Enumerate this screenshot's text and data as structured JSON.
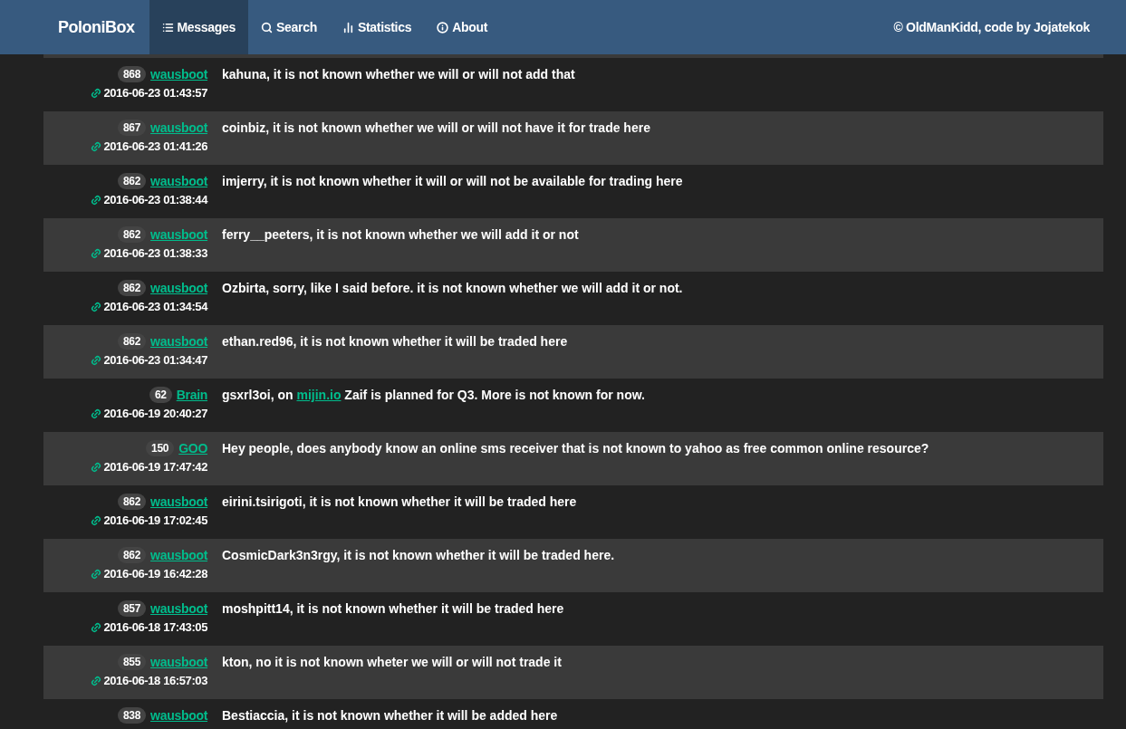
{
  "navbar": {
    "brand": "PoloniBox",
    "items": [
      {
        "label": "Messages",
        "kind": "list",
        "selected": true
      },
      {
        "label": "Search",
        "kind": "search",
        "selected": false
      },
      {
        "label": "Statistics",
        "kind": "chart",
        "selected": false
      },
      {
        "label": "About",
        "kind": "info",
        "selected": false
      }
    ],
    "credit": "© OldManKidd, code by Jojatekok"
  },
  "messages": [
    {
      "count": "868",
      "user": "wausboot",
      "time": "2016-06-23 01:43:57",
      "parts": [
        {
          "kind": "text",
          "text": "kahuna, it is not known whether we will or will not add that"
        }
      ]
    },
    {
      "count": "867",
      "user": "wausboot",
      "time": "2016-06-23 01:41:26",
      "parts": [
        {
          "kind": "text",
          "text": "coinbiz, it is not known whether we will or will not have it for trade here"
        }
      ]
    },
    {
      "count": "862",
      "user": "wausboot",
      "time": "2016-06-23 01:38:44",
      "parts": [
        {
          "kind": "text",
          "text": "imjerry, it is not known whether it will or will not be available for trading here"
        }
      ]
    },
    {
      "count": "862",
      "user": "wausboot",
      "time": "2016-06-23 01:38:33",
      "parts": [
        {
          "kind": "text",
          "text": "ferry__peeters, it is not known whether we will add it or not"
        }
      ]
    },
    {
      "count": "862",
      "user": "wausboot",
      "time": "2016-06-23 01:34:54",
      "parts": [
        {
          "kind": "text",
          "text": "Ozbirta, sorry, like I said before. it is not known whether we will add it or not."
        }
      ]
    },
    {
      "count": "862",
      "user": "wausboot",
      "time": "2016-06-23 01:34:47",
      "parts": [
        {
          "kind": "text",
          "text": "ethan.red96, it is not known whether it will be traded here"
        }
      ]
    },
    {
      "count": "62",
      "user": "Brain",
      "time": "2016-06-19 20:40:27",
      "parts": [
        {
          "kind": "text",
          "text": "gsxrl3oi, on "
        },
        {
          "kind": "link",
          "text": "mijin.io"
        },
        {
          "kind": "text",
          "text": " Zaif is planned for Q3. More is not known for now."
        }
      ]
    },
    {
      "count": "150",
      "user": "GOO",
      "time": "2016-06-19 17:47:42",
      "parts": [
        {
          "kind": "text",
          "text": "Hey people, does anybody know an online sms receiver that is not known to yahoo as free common online resource?"
        }
      ]
    },
    {
      "count": "862",
      "user": "wausboot",
      "time": "2016-06-19 17:02:45",
      "parts": [
        {
          "kind": "text",
          "text": "eirini.tsirigoti, it is not known whether it will be traded here"
        }
      ]
    },
    {
      "count": "862",
      "user": "wausboot",
      "time": "2016-06-19 16:42:28",
      "parts": [
        {
          "kind": "text",
          "text": "CosmicDark3n3rgy, it is not known whether it will be traded here."
        }
      ]
    },
    {
      "count": "857",
      "user": "wausboot",
      "time": "2016-06-18 17:43:05",
      "parts": [
        {
          "kind": "text",
          "text": "moshpitt14, it is not known whether it will be traded here"
        }
      ]
    },
    {
      "count": "855",
      "user": "wausboot",
      "time": "2016-06-18 16:57:03",
      "parts": [
        {
          "kind": "text",
          "text": "kton, no it is not known wheter we will or will not trade it"
        }
      ]
    },
    {
      "count": "838",
      "user": "wausboot",
      "parts": [
        {
          "kind": "text",
          "text": "Bestiaccia, it is not known whether it will be added here"
        }
      ]
    }
  ]
}
